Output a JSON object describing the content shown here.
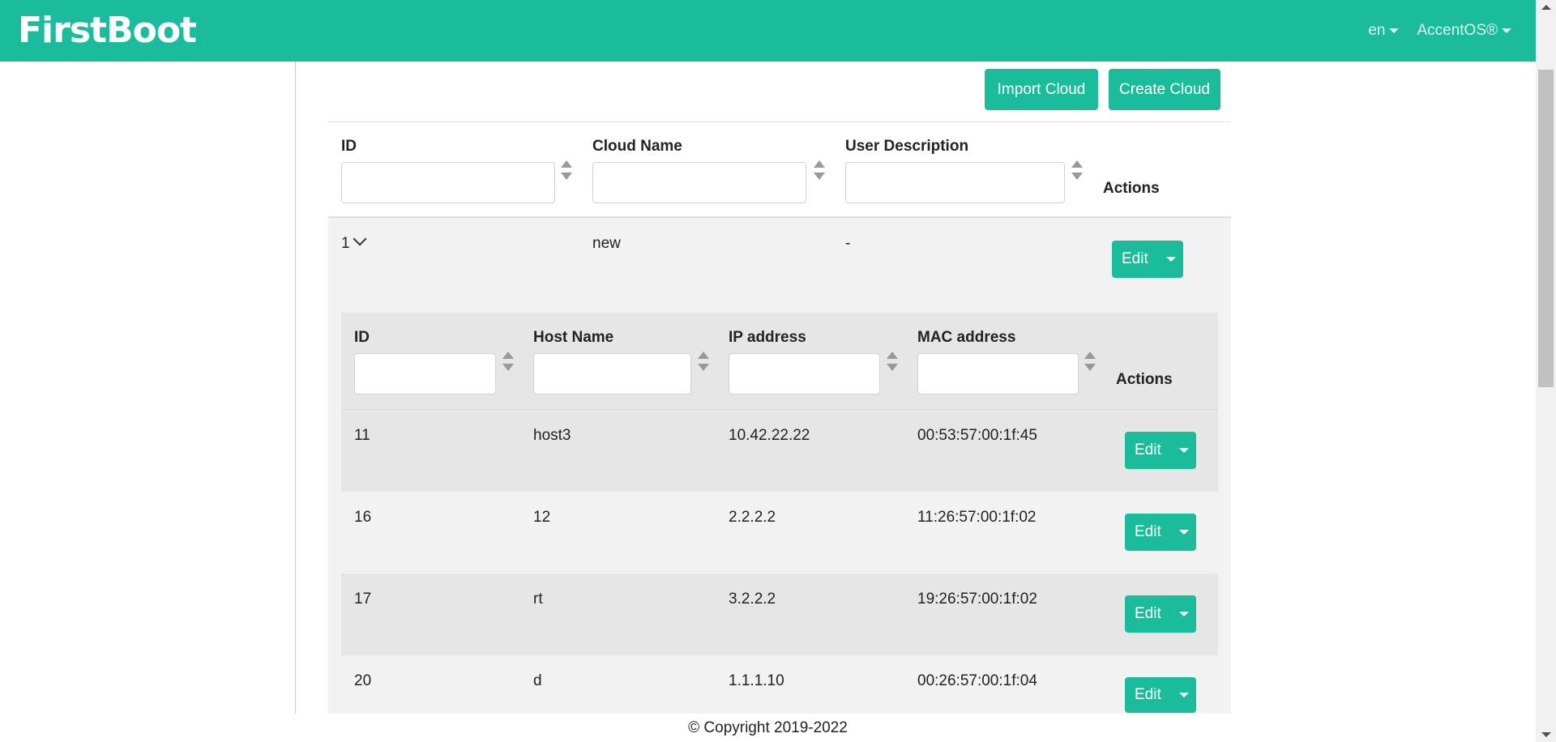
{
  "navbar": {
    "brand": "FirstBoot",
    "language": "en",
    "user": "AccentOS®"
  },
  "toolbar": {
    "import_label": "Import Cloud",
    "create_label": "Create Cloud"
  },
  "clouds_table": {
    "headers": {
      "id": "ID",
      "name": "Cloud Name",
      "description": "User Description",
      "actions": "Actions"
    },
    "rows": [
      {
        "id": "1",
        "name": "new",
        "description": "-",
        "action": "Edit"
      }
    ]
  },
  "hosts_table": {
    "headers": {
      "id": "ID",
      "host": "Host Name",
      "ip": "IP address",
      "mac": "MAC address",
      "actions": "Actions"
    },
    "rows": [
      {
        "id": "11",
        "host": "host3",
        "ip": "10.42.22.22",
        "mac": "00:53:57:00:1f:45",
        "action": "Edit"
      },
      {
        "id": "16",
        "host": "12",
        "ip": "2.2.2.2",
        "mac": "11:26:57:00:1f:02",
        "action": "Edit"
      },
      {
        "id": "17",
        "host": "rt",
        "ip": "3.2.2.2",
        "mac": "19:26:57:00:1f:02",
        "action": "Edit"
      },
      {
        "id": "20",
        "host": "d",
        "ip": "1.1.1.10",
        "mac": "00:26:57:00:1f:04",
        "action": "Edit"
      }
    ]
  },
  "footer": {
    "copyright": "© Copyright 2019-2022"
  },
  "colors": {
    "accent": "#1abc9c"
  }
}
